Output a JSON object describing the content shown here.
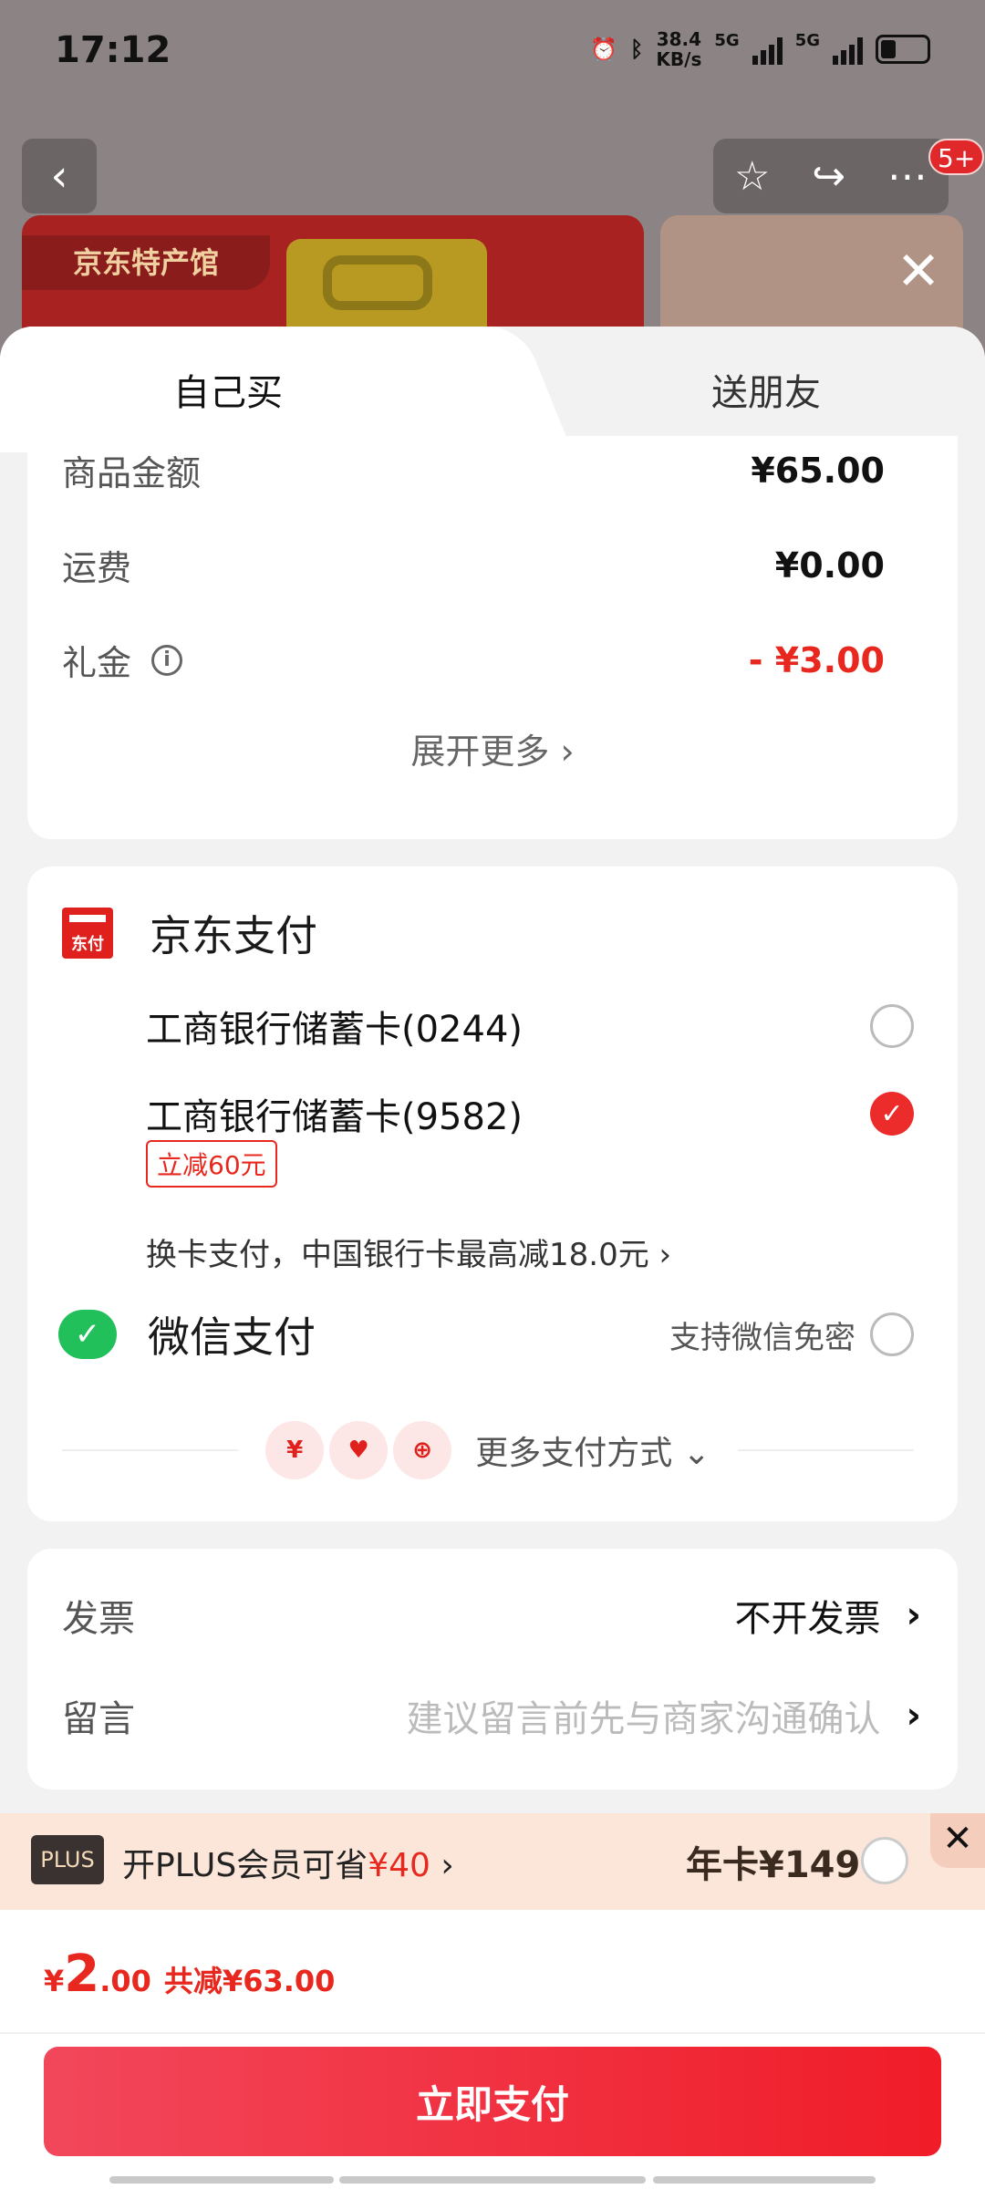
{
  "status": {
    "time": "17:12",
    "speed_value": "38.4",
    "speed_unit": "KB/s",
    "net1": "5G",
    "net2": "5G"
  },
  "header": {
    "notification_badge": "5+",
    "promo_store_name": "京东特产馆"
  },
  "tabs": {
    "buy_self": "自己买",
    "gift_friend": "送朋友"
  },
  "summary": {
    "rows": [
      {
        "label": "商品金额",
        "value": "¥65.00"
      },
      {
        "label": "运费",
        "value": "¥0.00"
      },
      {
        "label": "礼金",
        "value": "- ¥3.00"
      }
    ],
    "expand_label": "展开更多 ›"
  },
  "payment": {
    "jd_title": "京东支付",
    "jd_icon_text": "东付",
    "cards": [
      {
        "name": "工商银行储蓄卡(0244)",
        "selected": false
      },
      {
        "name": "工商银行储蓄卡(9582)",
        "selected": true
      }
    ],
    "discount_tag": "立减60元",
    "switch_card_text": "换卡支付，中国银行卡最高减18.0元 ›",
    "wechat_title": "微信支付",
    "wechat_option": "支持微信免密",
    "more_methods": "更多支付方式 ⌄"
  },
  "invoice": {
    "invoice_label": "发票",
    "invoice_value": "不开发票",
    "message_label": "留言",
    "message_placeholder": "建议留言前先与商家沟通确认"
  },
  "plus": {
    "badge": "PLUS",
    "text_prefix": "开PLUS会员可省",
    "text_amount": "¥40",
    "text_suffix": " ›",
    "price": "年卡¥149"
  },
  "footer": {
    "currency": "¥",
    "amount_int": "2",
    "amount_dec": ".00",
    "saved": "共减¥63.00",
    "pay_button": "立即支付"
  },
  "colors": {
    "accent_red": "#e8281e",
    "wechat_green": "#21c05a"
  }
}
